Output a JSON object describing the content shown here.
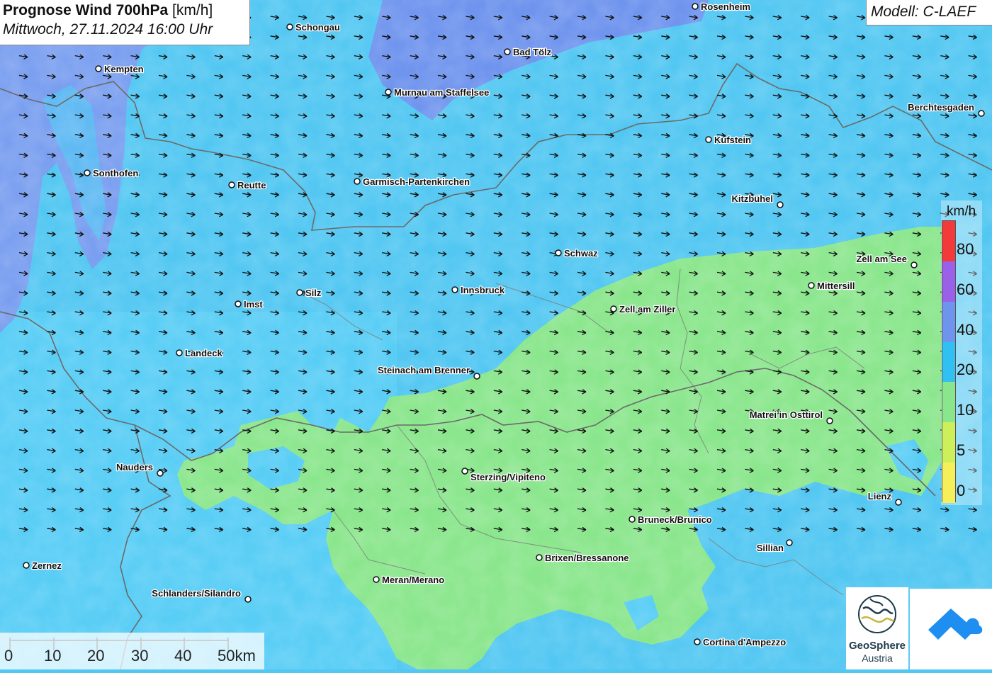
{
  "title": {
    "bold": "Prognose Wind 700hPa",
    "unit": "[km/h]",
    "datetime": "Mittwoch, 27.11.2024 16:00 Uhr"
  },
  "model": "Modell: C-LAEF",
  "legend": {
    "unit": "km/h",
    "classes": [
      {
        "label": "80",
        "color": "#f23a3a"
      },
      {
        "label": "60",
        "color": "#9a60e8"
      },
      {
        "label": "40",
        "color": "#6f94ee"
      },
      {
        "label": "20",
        "color": "#30c0f2"
      },
      {
        "label": "10",
        "color": "#8ae68c"
      },
      {
        "label": "5",
        "color": "#cdf05a"
      },
      {
        "label": "0",
        "color": "#f5f05a"
      }
    ]
  },
  "scale_bar": {
    "labels": [
      "0",
      "10",
      "20",
      "30",
      "40",
      "50km"
    ]
  },
  "cities": [
    {
      "name": "Rosenheim"
    },
    {
      "name": "Schongau"
    },
    {
      "name": "Bad Tölz"
    },
    {
      "name": "Kempten"
    },
    {
      "name": "Murnau am Staffelsee"
    },
    {
      "name": "Berchtesgaden"
    },
    {
      "name": "Kufstein"
    },
    {
      "name": "Sonthofen"
    },
    {
      "name": "Reutte"
    },
    {
      "name": "Garmisch-Partenkirchen"
    },
    {
      "name": "Kitzbühel"
    },
    {
      "name": "Schwaz"
    },
    {
      "name": "Zell am See"
    },
    {
      "name": "Mittersill"
    },
    {
      "name": "Silz"
    },
    {
      "name": "Innsbruck"
    },
    {
      "name": "Imst"
    },
    {
      "name": "Zell am Ziller"
    },
    {
      "name": "Landeck"
    },
    {
      "name": "Steinach am Brenner"
    },
    {
      "name": "Matrei in Osttirol"
    },
    {
      "name": "Nauders"
    },
    {
      "name": "Sterzing/Vipiteno"
    },
    {
      "name": "Lienz"
    },
    {
      "name": "Bruneck/Brunico"
    },
    {
      "name": "Sillian"
    },
    {
      "name": "Brixen/Bressanone"
    },
    {
      "name": "Zernez"
    },
    {
      "name": "Meran/Merano"
    },
    {
      "name": "Schlanders/Silandro"
    },
    {
      "name": "Cortina d'Ampezzo"
    }
  ],
  "colors": {
    "field_blue": "#52c7f2",
    "field_green": "#8ae68c",
    "field_violet": "#6f94ee",
    "arrow": "#111111",
    "border": "#666666"
  },
  "logo": {
    "line1": "GeoSphere",
    "line2": "Austria"
  }
}
